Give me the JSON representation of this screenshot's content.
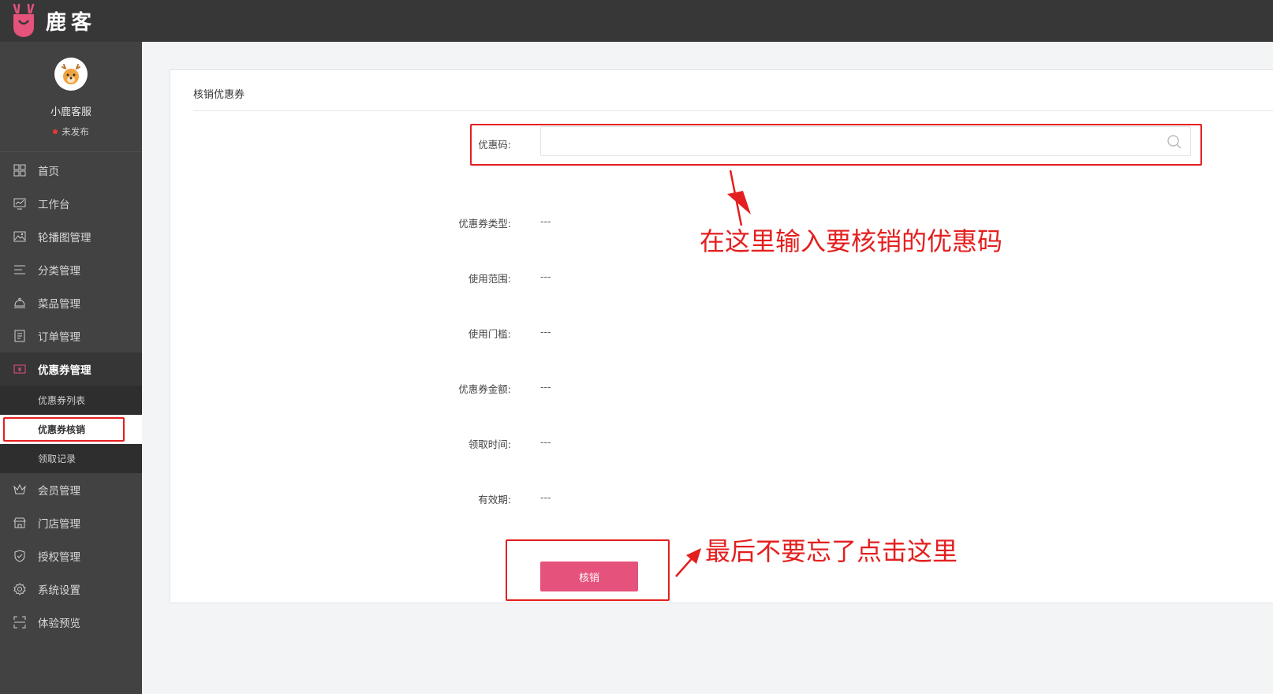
{
  "app": {
    "brand": "鹿客"
  },
  "profile": {
    "name": "小鹿客服",
    "status": "未发布"
  },
  "sidebar": {
    "items": [
      {
        "label": "首页",
        "icon": "grid-icon"
      },
      {
        "label": "工作台",
        "icon": "monitor-chart-icon"
      },
      {
        "label": "轮播图管理",
        "icon": "image-icon"
      },
      {
        "label": "分类管理",
        "icon": "lines-icon"
      },
      {
        "label": "菜品管理",
        "icon": "cloche-icon"
      },
      {
        "label": "订单管理",
        "icon": "document-icon"
      },
      {
        "label": "优惠券管理",
        "icon": "coupon-icon"
      },
      {
        "label": "会员管理",
        "icon": "crown-icon"
      },
      {
        "label": "门店管理",
        "icon": "store-icon"
      },
      {
        "label": "授权管理",
        "icon": "shield-icon"
      },
      {
        "label": "系统设置",
        "icon": "gear-icon"
      },
      {
        "label": "体验预览",
        "icon": "scan-icon"
      }
    ],
    "sub_items": [
      {
        "label": "优惠券列表"
      },
      {
        "label": "优惠券核销"
      },
      {
        "label": "领取记录"
      }
    ]
  },
  "panel": {
    "title": "核销优惠券",
    "code_label": "优惠码:",
    "code_value": "",
    "code_placeholder": "",
    "fields": [
      {
        "label": "优惠券类型:",
        "value": "---"
      },
      {
        "label": "使用范围:",
        "value": "---"
      },
      {
        "label": "使用门槛:",
        "value": "---"
      },
      {
        "label": "优惠券金额:",
        "value": "---"
      },
      {
        "label": "领取时间:",
        "value": "---"
      },
      {
        "label": "有效期:",
        "value": "---"
      }
    ],
    "submit_label": "核销"
  },
  "annotations": {
    "input_hint": "在这里输入要核销的优惠码",
    "button_hint": "最后不要忘了点击这里"
  },
  "colors": {
    "topbar": "#373737",
    "sidebar": "#424242",
    "accent": "#e5527c",
    "annotation": "#e41f1f"
  }
}
